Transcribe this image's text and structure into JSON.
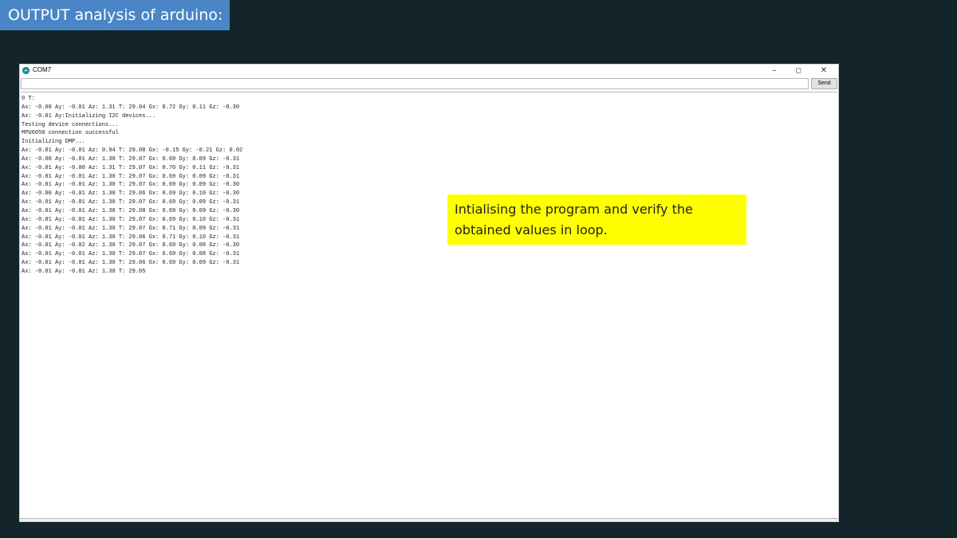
{
  "slide": {
    "title": "OUTPUT analysis of arduino:",
    "callout": "Intialising the program and verify the obtained values in loop."
  },
  "window": {
    "title": "COM7",
    "app_icon": "arduino-icon",
    "controls": {
      "minimize": "–",
      "maximize": "◻",
      "close": "✕"
    }
  },
  "serial": {
    "input_value": "",
    "send_label": "Send",
    "lines": [
      "0 T:",
      "Ax: -0.00 Ay: -0.01 Az: 1.31 T: 29.04 Gx: 0.72 Gy: 0.11 Gz: -0.30",
      "Ax: -0.01 Ay:Initializing I2C devices...",
      "Testing device connections...",
      "MPU6050 connection successful",
      "Initializing DMP...",
      "Ax: -0.01 Ay: -0.01 Az: 0.94 T: 29.08 Gx: -0.15 Gy: -0.21 Gz: 0.02",
      "Ax: -0.00 Ay: -0.01 Az: 1.30 T: 29.07 Gx: 0.69 Gy: 0.09 Gz: -0.31",
      "Ax: -0.01 Ay: -0.00 Az: 1.31 T: 29.07 Gx: 0.70 Gy: 0.11 Gz: -0.31",
      "Ax: -0.01 Ay: -0.01 Az: 1.30 T: 29.07 Gx: 0.69 Gy: 0.09 Gz: -0.31",
      "Ax: -0.01 Ay: -0.01 Az: 1.30 T: 29.07 Gx: 0.69 Gy: 0.09 Gz: -0.30",
      "Ax: -0.00 Ay: -0.01 Az: 1.30 T: 29.06 Gx: 0.69 Gy: 0.10 Gz: -0.30",
      "Ax: -0.01 Ay: -0.01 Az: 1.30 T: 29.07 Gx: 0.69 Gy: 0.09 Gz: -0.31",
      "Ax: -0.01 Ay: -0.01 Az: 1.30 T: 29.08 Gx: 0.69 Gy: 0.09 Gz: -0.30",
      "Ax: -0.01 Ay: -0.01 Az: 1.30 T: 29.07 Gx: 0.69 Gy: 0.10 Gz: -0.31",
      "Ax: -0.01 Ay: -0.01 Az: 1.30 T: 29.07 Gx: 0.71 Gy: 0.09 Gz: -0.31",
      "Ax: -0.01 Ay: -0.01 Az: 1.30 T: 29.06 Gx: 0.71 Gy: 0.10 Gz: -0.31",
      "Ax: -0.01 Ay: -0.02 Az: 1.30 T: 29.07 Gx: 0.69 Gy: 0.08 Gz: -0.30",
      "Ax: -0.01 Ay: -0.01 Az: 1.30 T: 29.07 Gx: 0.69 Gy: 0.08 Gz: -0.31",
      "Ax: -0.01 Ay: -0.01 Az: 1.30 T: 29.06 Gx: 0.69 Gy: 0.09 Gz: -0.31",
      "Ax: -0.01 Ay: -0.01 Az: 1.30 T: 29.05"
    ]
  },
  "colors": {
    "background": "#13252a",
    "title_band": "#4a86c6",
    "callout": "#ffff00"
  }
}
